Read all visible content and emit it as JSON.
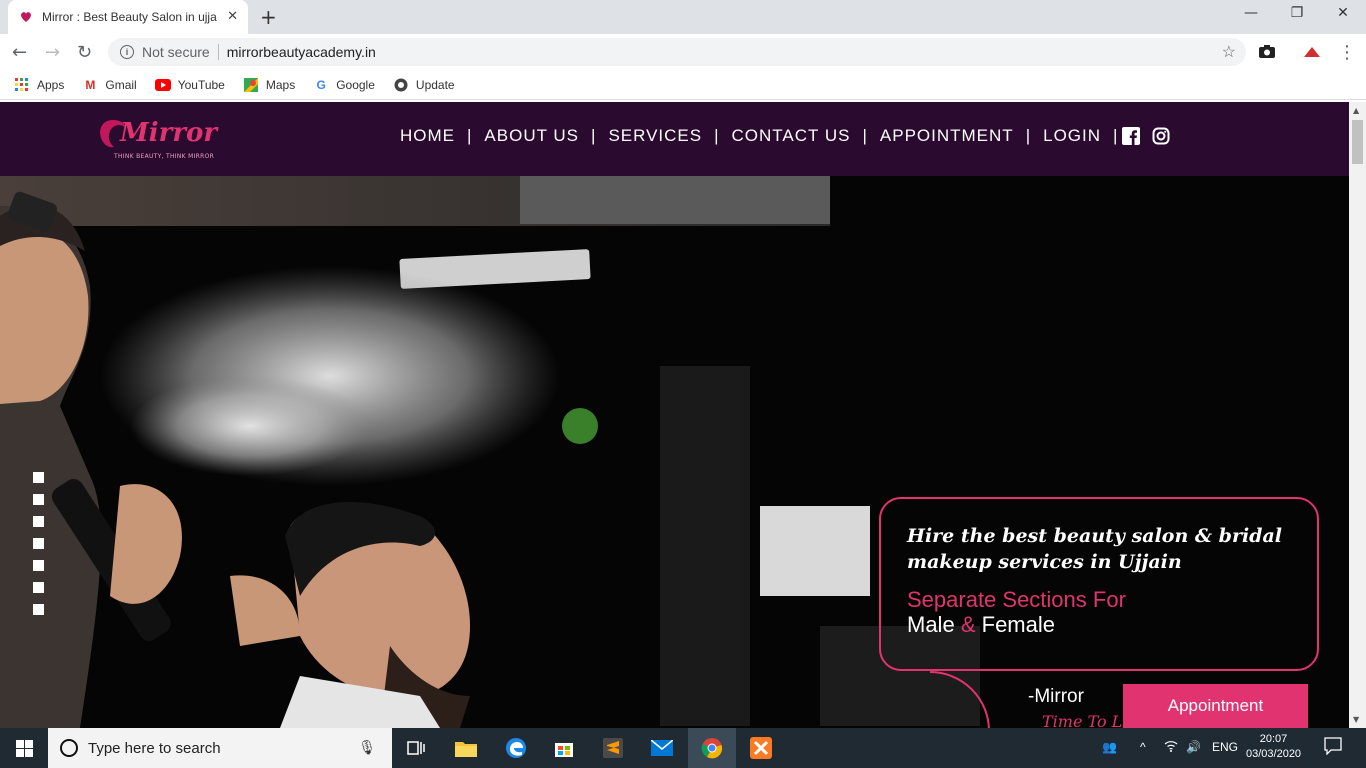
{
  "browser": {
    "tab_title": "Mirror : Best Beauty Salon in ujjain",
    "new_tab_label": "+",
    "window_controls": [
      "minimize",
      "restore",
      "close"
    ],
    "security_label": "Not secure",
    "url": "mirrorbeautyacademy.in",
    "bookmarks": [
      {
        "label": "Apps",
        "icon": "apps-grid-icon"
      },
      {
        "label": "Gmail",
        "icon": "gmail-icon"
      },
      {
        "label": "YouTube",
        "icon": "youtube-icon"
      },
      {
        "label": "Maps",
        "icon": "maps-icon"
      },
      {
        "label": "Google",
        "icon": "google-icon"
      },
      {
        "label": "Update",
        "icon": "update-icon"
      }
    ]
  },
  "site": {
    "logo_text": "Mirror",
    "logo_tagline": "THINK BEAUTY, THINK MIRROR",
    "menu": [
      "HOME",
      "ABOUT US",
      "SERVICES",
      "CONTACT US",
      "APPOINTMENT",
      "LOGIN"
    ],
    "social": [
      "facebook-icon",
      "instagram-icon"
    ],
    "hero": {
      "slider_dots": 7,
      "card_script": "Hire the best beauty salon & bridal makeup services in Ujjain",
      "card_line1": "Separate Sections For",
      "card_line2_a": "Male",
      "card_line2_amp": "&",
      "card_line2_b": "Female",
      "signature": "-Mirror",
      "signature_sub": "Time To L",
      "appointment_button": "Appointment"
    }
  },
  "colors": {
    "accent": "#e0336f",
    "header_bg": "#2b0a2f"
  },
  "taskbar": {
    "search_placeholder": "Type here to search",
    "lang": "ENG",
    "time": "20:07",
    "date": "03/03/2020"
  }
}
